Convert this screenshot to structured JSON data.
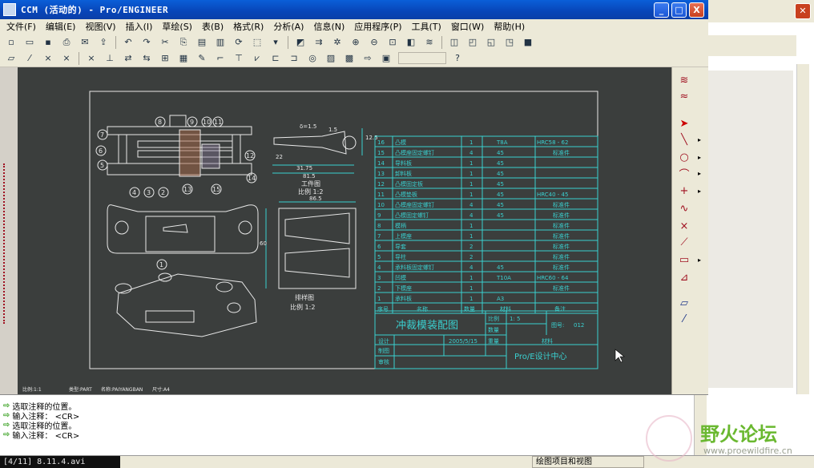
{
  "window": {
    "title": "CCM (活动的) - Pro/ENGINEER",
    "min_label": "_",
    "max_label": "□",
    "close_label": "X"
  },
  "menu": [
    "文件(F)",
    "编辑(E)",
    "视图(V)",
    "插入(I)",
    "草绘(S)",
    "表(B)",
    "格式(R)",
    "分析(A)",
    "信息(N)",
    "应用程序(P)",
    "工具(T)",
    "窗口(W)",
    "帮助(H)"
  ],
  "drawing": {
    "part_caption": "工件图",
    "part_scale": "比例 1:2",
    "strip_caption": "排样图",
    "strip_scale": "比例 1:2",
    "dims": {
      "d1": "δ=1.5",
      "d2": "22",
      "d3": "31.75",
      "d4": "81.5",
      "d5": "86.5",
      "d6": "60",
      "d7": "12.5",
      "d8": "1.5"
    },
    "balloons": [
      "1",
      "2",
      "3",
      "4",
      "5",
      "6",
      "7",
      "8",
      "9",
      "10",
      "11",
      "12",
      "13",
      "14",
      "15",
      "16"
    ],
    "bom_rows": [
      {
        "no": "16",
        "name": "凸模",
        "qty": "1",
        "mat": "T8A",
        "note": "HRC58 - 62"
      },
      {
        "no": "15",
        "name": "凸模座固定螺钉",
        "qty": "4",
        "mat": "45",
        "note": "标准件"
      },
      {
        "no": "14",
        "name": "导料板",
        "qty": "1",
        "mat": "45",
        "note": ""
      },
      {
        "no": "13",
        "name": "卸料板",
        "qty": "1",
        "mat": "45",
        "note": ""
      },
      {
        "no": "12",
        "name": "凸模固定板",
        "qty": "1",
        "mat": "45",
        "note": ""
      },
      {
        "no": "11",
        "name": "凸模垫板",
        "qty": "1",
        "mat": "45",
        "note": "HRC40 - 45"
      },
      {
        "no": "10",
        "name": "凸模座固定螺钉",
        "qty": "4",
        "mat": "45",
        "note": "标准件"
      },
      {
        "no": "9",
        "name": "凸模固定螺钉",
        "qty": "4",
        "mat": "45",
        "note": "标准件"
      },
      {
        "no": "8",
        "name": "模柄",
        "qty": "1",
        "mat": "",
        "note": "标准件"
      },
      {
        "no": "7",
        "name": "上模座",
        "qty": "1",
        "mat": "",
        "note": "标准件"
      },
      {
        "no": "6",
        "name": "导套",
        "qty": "2",
        "mat": "",
        "note": "标准件"
      },
      {
        "no": "5",
        "name": "导柱",
        "qty": "2",
        "mat": "",
        "note": "标准件"
      },
      {
        "no": "4",
        "name": "承料板固定螺钉",
        "qty": "4",
        "mat": "45",
        "note": "标准件"
      },
      {
        "no": "3",
        "name": "凹模",
        "qty": "1",
        "mat": "T10A",
        "note": "HRC60 - 64"
      },
      {
        "no": "2",
        "name": "下模座",
        "qty": "1",
        "mat": "",
        "note": "标准件"
      },
      {
        "no": "1",
        "name": "承料板",
        "qty": "1",
        "mat": "A3",
        "note": ""
      }
    ],
    "bom_header": {
      "no": "序号",
      "name": "名称",
      "qty": "数量",
      "mat": "材料",
      "note": "备注"
    },
    "title_block": {
      "title": "冲裁模装配图",
      "scale_label": "比例",
      "scale_value": "1: 5",
      "drawing_no_label": "图号:",
      "drawing_no": "012",
      "qty_label": "数量",
      "material_label": "材料",
      "designer_label": "设计",
      "date": "2005/5/15",
      "weight_label": "重量",
      "drafter_label": "制图",
      "checker_label": "审核",
      "company": "Pro/E设计中心"
    },
    "footer": {
      "scale": "比例:1:1",
      "type": "类型:PART",
      "name": "名称:PAIYANGBAN",
      "size": "尺寸:A4"
    }
  },
  "messages": [
    "选取注释的位置。",
    "输入注释：       <CR>",
    "选取注释的位置。",
    "输入注释：       <CR>"
  ],
  "status": {
    "file": "[4/11] 8.11.4.avi",
    "panel": "绘图项目和视图"
  },
  "watermark": {
    "cn": "野火论坛",
    "url": "www.proewildfire.cn"
  }
}
